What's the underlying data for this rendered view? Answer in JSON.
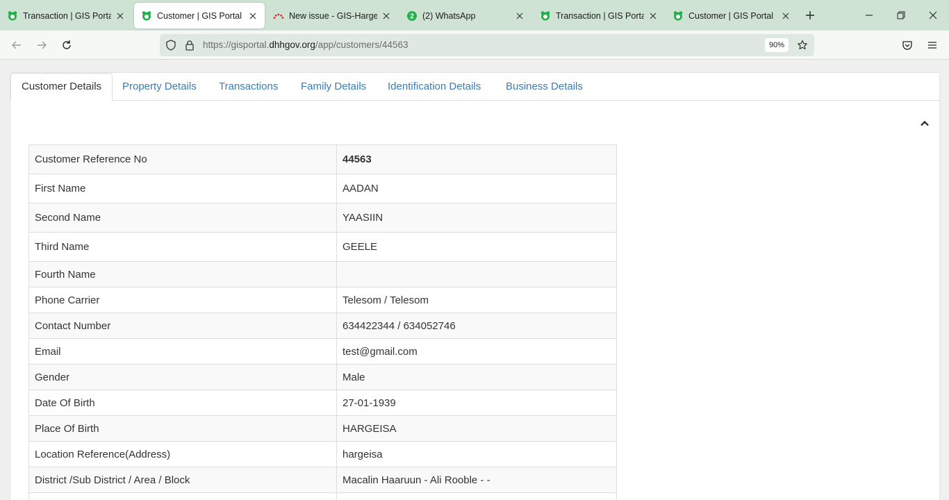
{
  "browser": {
    "tabs": [
      {
        "title": "Transaction | GIS Portal",
        "icon": "gis-portal-favicon"
      },
      {
        "title": "Customer | GIS Portal",
        "icon": "gis-portal-favicon"
      },
      {
        "title": "New issue - GIS-Hargesia",
        "icon": "issue-tracker-favicon"
      },
      {
        "title": "(2) WhatsApp",
        "icon": "whatsapp-favicon"
      },
      {
        "title": "Transaction | GIS Portal",
        "icon": "gis-portal-favicon"
      },
      {
        "title": "Customer | GIS Portal",
        "icon": "gis-portal-favicon"
      }
    ],
    "whatsapp_badge": "2",
    "url_prefix": "https://gisportal.",
    "url_host": "dhhgov.org",
    "url_path": "/app/customers/44563",
    "zoom": "90%",
    "colors": {
      "tabstrip": "#cfe3d5",
      "accent_green": "#23b04a"
    }
  },
  "page": {
    "tabs": [
      {
        "label": "Customer Details",
        "active": true
      },
      {
        "label": "Property Details",
        "active": false
      },
      {
        "label": "Transactions",
        "active": false
      },
      {
        "label": "Family Details",
        "active": false
      },
      {
        "label": "Identification Details",
        "active": false
      },
      {
        "label": "Business Details",
        "active": false
      }
    ],
    "link_color": "#3a7cb8",
    "details": [
      {
        "label": "Customer Reference No",
        "value": "44563"
      },
      {
        "label": "First Name",
        "value": "AADAN"
      },
      {
        "label": "Second Name",
        "value": "YAASIIN"
      },
      {
        "label": "Third Name",
        "value": "GEELE"
      },
      {
        "label": "Fourth Name",
        "value": ""
      },
      {
        "label": "Phone Carrier",
        "value": "Telesom / Telesom"
      },
      {
        "label": "Contact Number",
        "value": "634422344 / 634052746"
      },
      {
        "label": "Email",
        "value": "test@gmail.com"
      },
      {
        "label": "Gender",
        "value": "Male"
      },
      {
        "label": "Date Of Birth",
        "value": "27-01-1939"
      },
      {
        "label": "Place Of Birth",
        "value": "HARGEISA"
      },
      {
        "label": "Location Reference(Address)",
        "value": "hargeisa"
      },
      {
        "label": "District /Sub District / Area / Block",
        "value": "Macalin Haaruun - Ali Rooble - -"
      },
      {
        "label": "",
        "value": ""
      }
    ]
  }
}
